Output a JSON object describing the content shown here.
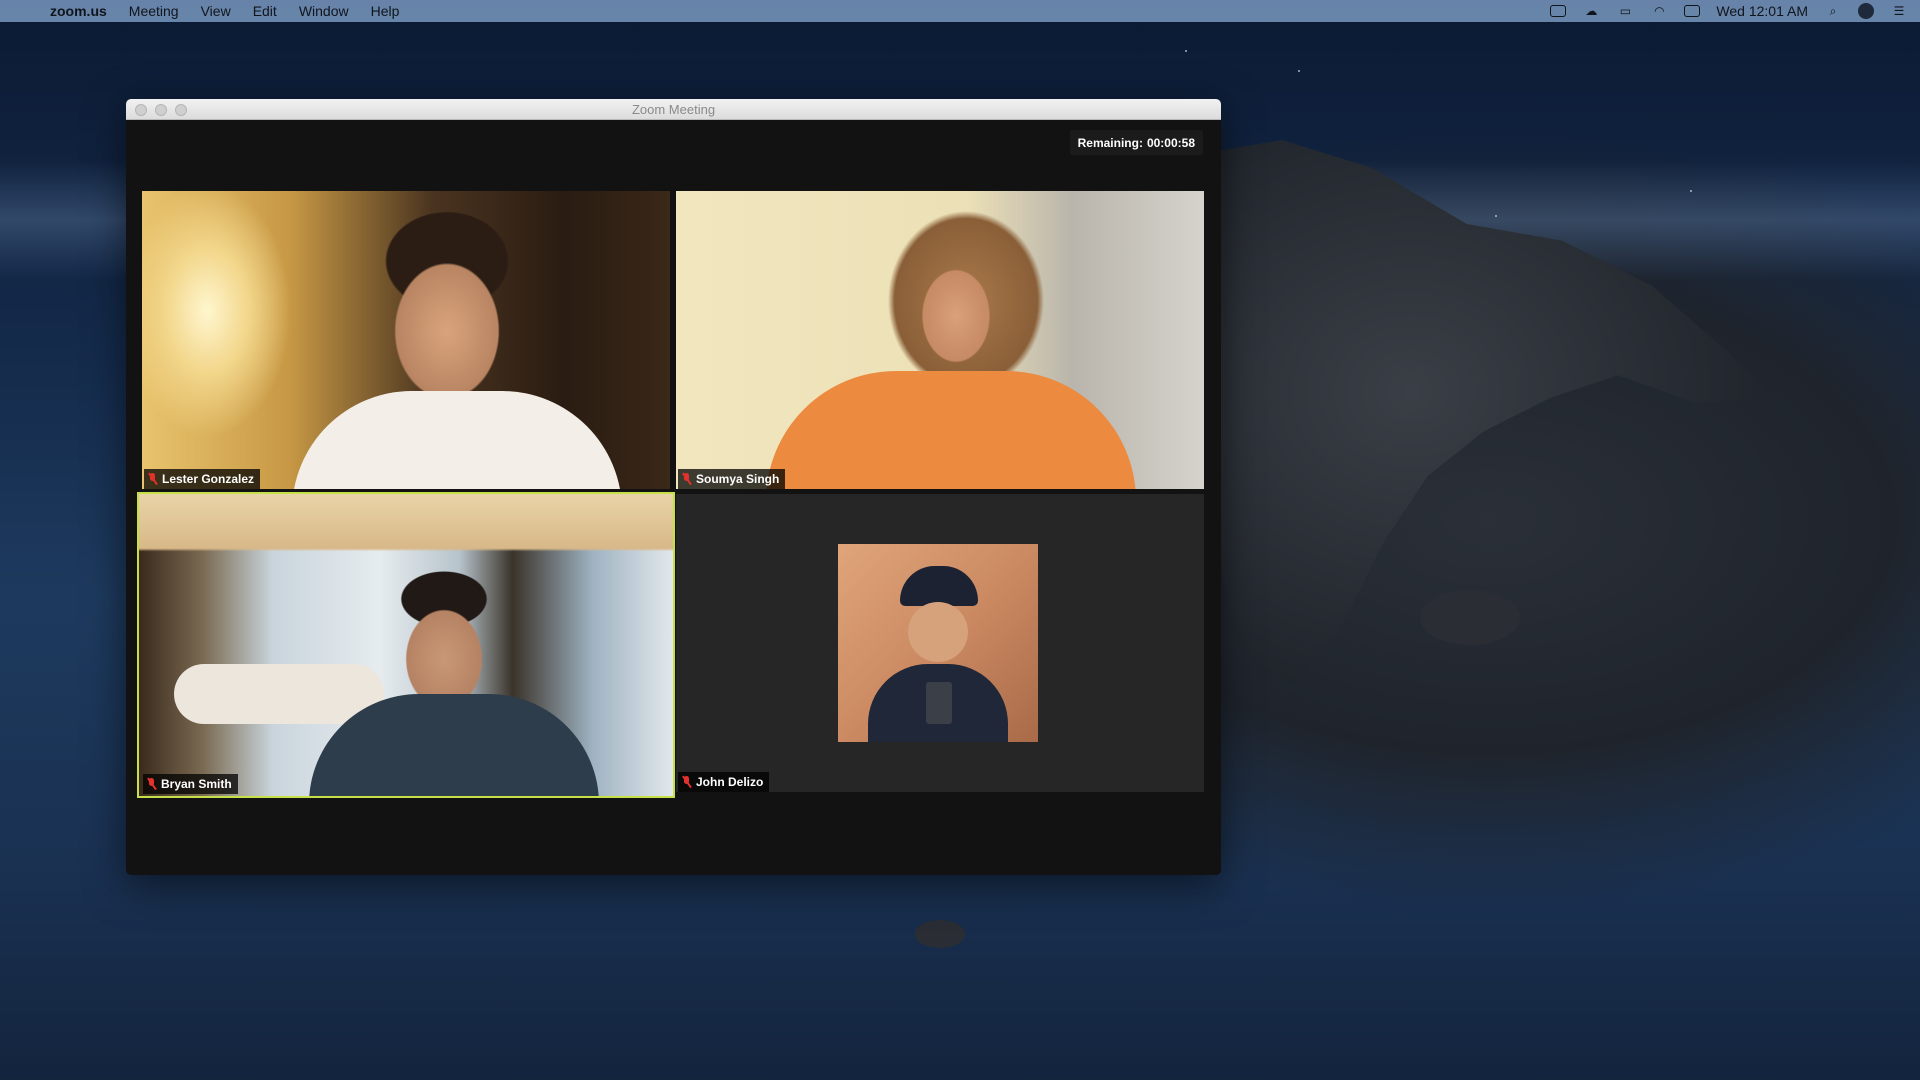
{
  "menubar": {
    "app_name": "zoom.us",
    "menus": [
      "Meeting",
      "View",
      "Edit",
      "Window",
      "Help"
    ],
    "clock": "Wed 12:01 AM"
  },
  "window": {
    "title": "Zoom Meeting"
  },
  "meeting": {
    "remaining_label": "Remaining:",
    "remaining_time": "00:00:58"
  },
  "participants": [
    {
      "name": "Lester Gonzalez",
      "muted": true,
      "active_speaker": false
    },
    {
      "name": "Soumya Singh",
      "muted": true,
      "active_speaker": false
    },
    {
      "name": "Bryan Smith",
      "muted": true,
      "active_speaker": true
    },
    {
      "name": "John Delizo",
      "muted": true,
      "active_speaker": false,
      "video_off": true
    }
  ],
  "colors": {
    "active_speaker_border": "#c6e04a",
    "muted_mic": "#e2322b"
  }
}
